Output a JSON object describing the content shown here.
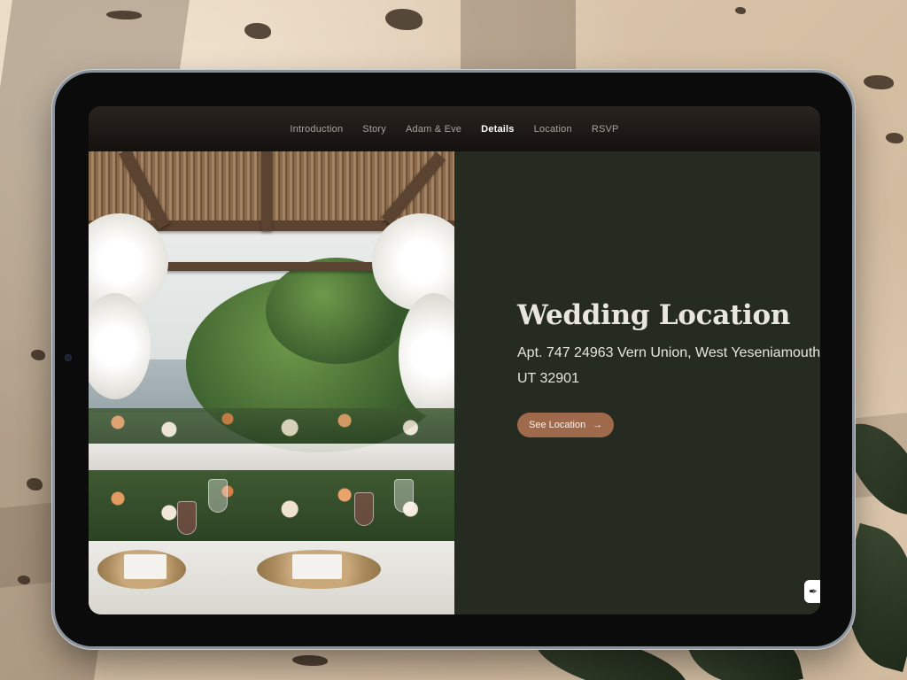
{
  "nav": {
    "items": [
      {
        "label": "Introduction",
        "active": false
      },
      {
        "label": "Story",
        "active": false
      },
      {
        "label": "Adam & Eve",
        "active": false
      },
      {
        "label": "Details",
        "active": true
      },
      {
        "label": "Location",
        "active": false
      },
      {
        "label": "RSVP",
        "active": false
      }
    ]
  },
  "details": {
    "title": "Wedding Location",
    "address_line1": "Apt. 747 24963 Vern Union, West Yeseniamouth,",
    "address_line2": "UT 32901",
    "cta_label": "See Location",
    "cta_icon": "arrow-right-icon"
  },
  "theme": {
    "panel_bg": "#262b21",
    "accent": "#9f6a4b",
    "nav_bg": "#15110f"
  },
  "icons": {
    "float_button": "feather-icon"
  }
}
